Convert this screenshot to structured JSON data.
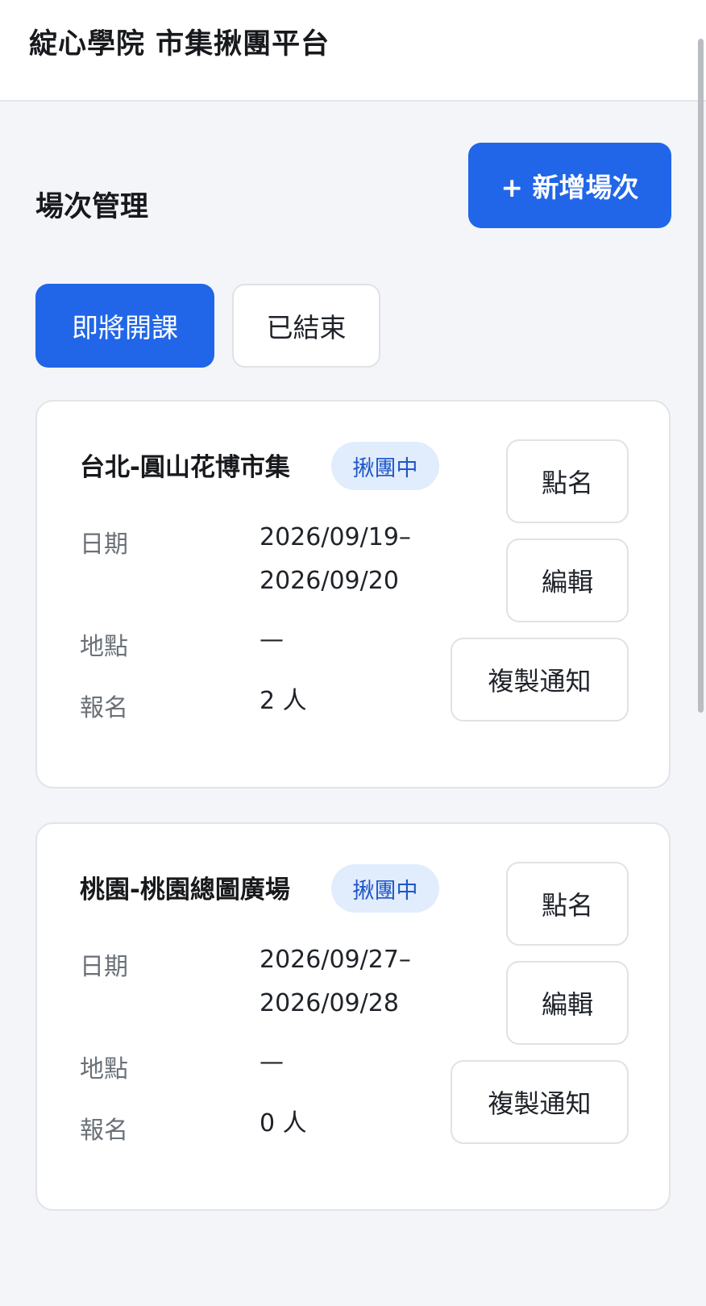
{
  "header": {
    "app_title": "綻心學院 市集揪團平台"
  },
  "page": {
    "title": "場次管理",
    "add_button_label": "+ 新增場次"
  },
  "tabs": [
    {
      "label": "即將開課",
      "active": true
    },
    {
      "label": "已結束",
      "active": false
    }
  ],
  "field_labels": {
    "date": "日期",
    "location": "地點",
    "signup": "報名"
  },
  "sessions": [
    {
      "title": "台北-圓山花博市集",
      "status": "揪團中",
      "date_line1": "2026/09/19–",
      "date_line2": "2026/09/20",
      "location": "—",
      "signup": "2 人",
      "buttons": {
        "rollcall": "點名",
        "edit": "編輯",
        "copy_notice": "複製通知"
      }
    },
    {
      "title": "桃園-桃園總圖廣場",
      "status": "揪團中",
      "date_line1": "2026/09/27–",
      "date_line2": "2026/09/28",
      "location": "—",
      "signup": "0 人",
      "buttons": {
        "rollcall": "點名",
        "edit": "編輯",
        "copy_notice": "複製通知"
      }
    }
  ],
  "colors": {
    "accent": "#2166e8",
    "badge_bg": "#e1ecfd",
    "badge_text": "#1f56c8",
    "page_bg": "#f3f5f8"
  }
}
